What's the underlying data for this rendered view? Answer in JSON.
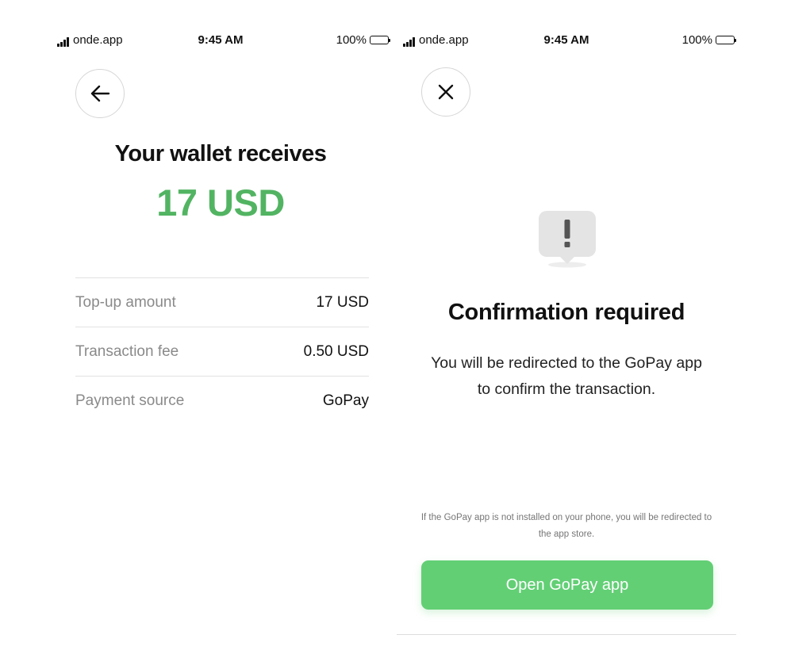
{
  "status_bar": {
    "carrier": "onde.app",
    "time": "9:45 AM",
    "battery": "100%"
  },
  "wallet_screen": {
    "back_icon": "arrow-left-icon",
    "title": "Your wallet receives",
    "amount": "17 USD",
    "amount_color": "#52b462",
    "details": [
      {
        "label": "Top-up amount",
        "value": "17 USD"
      },
      {
        "label": "Transaction fee",
        "value": "0.50 USD"
      },
      {
        "label": "Payment source",
        "value": "GoPay"
      }
    ]
  },
  "confirm_screen": {
    "close_icon": "close-icon",
    "alert_icon": "exclamation-bubble-icon",
    "title": "Confirmation required",
    "message": "You will be redirected to the GoPay app to confirm the transaction.",
    "note": "If the GoPay app is not installed on your phone, you will be redirected to the app store.",
    "button_label": "Open GoPay app",
    "button_color": "#62cf75"
  }
}
